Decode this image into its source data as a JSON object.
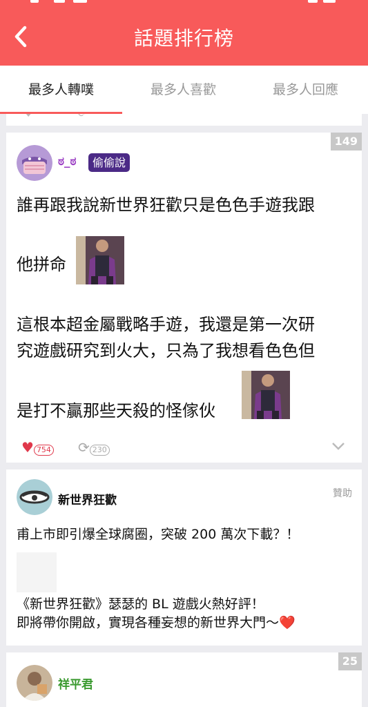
{
  "header": {
    "title": "話題排行榜",
    "back_icon": "back-arrow-icon"
  },
  "tabs": [
    {
      "label": "最多人轉噗",
      "active": true
    },
    {
      "label": "最多人喜歡",
      "active": false
    },
    {
      "label": "最多人回應",
      "active": false
    }
  ],
  "colors": {
    "accent": "#f85a5a",
    "badge": "#4b2a86",
    "username_purple": "#9b3fc4",
    "username_green": "#3a9a2f"
  },
  "posts": [
    {
      "rank": "149",
      "username": "ಠ_ಠ",
      "badge": "偷偷說",
      "lines": [
        "誰再跟我說新世界狂歡只是色色手遊我跟",
        "他拼命",
        "這根本超金屬戰略手遊，我還是第一次研",
        "究遊戲研究到火大，只為了我想看色色但",
        "是打不贏那些天殺的怪傢伙"
      ],
      "likes": "754",
      "replurks": "230"
    },
    {
      "username": "新世界狂歡",
      "sponsor_label": "贊助",
      "line1": "甫上市即引爆全球腐圈，突破 200 萬次下載？！",
      "line2": "《新世界狂歡》瑟瑟的 BL 遊戲火熱好評！",
      "line3": "即將帶你開啟，實現各種妄想的新世界大門～❤️"
    },
    {
      "rank": "25",
      "username": "祥平君"
    }
  ]
}
